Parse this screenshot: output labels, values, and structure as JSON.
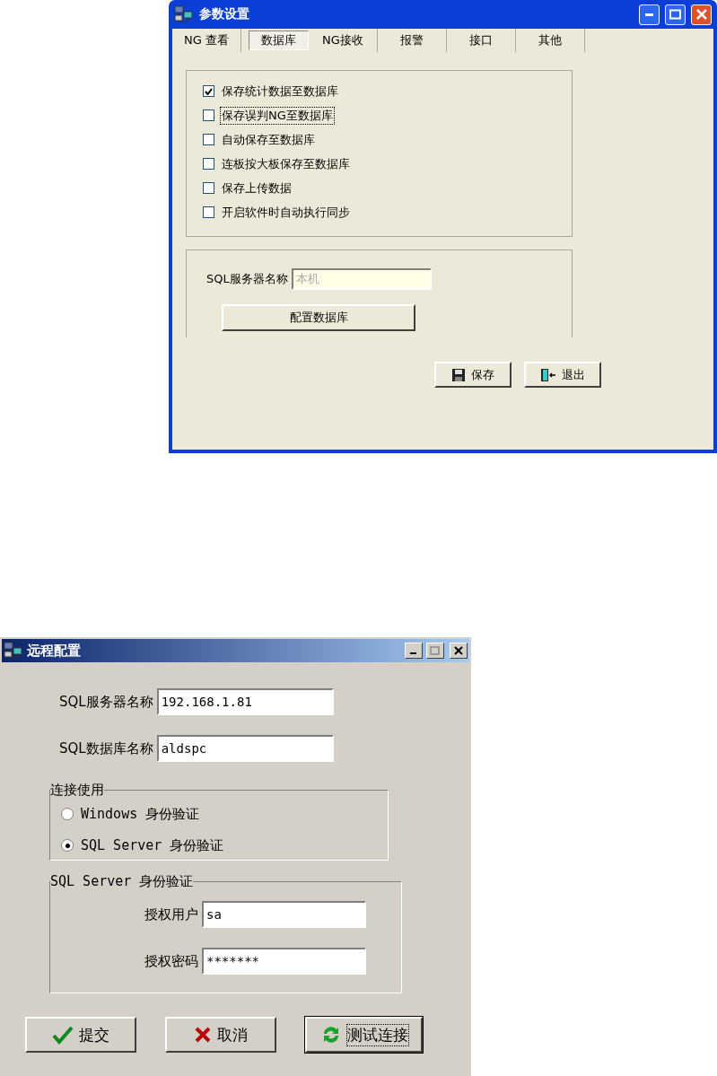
{
  "settings_window": {
    "title": "参数设置",
    "tabs": [
      {
        "label": "NG 查看",
        "selected": false
      },
      {
        "label": "数据库",
        "selected": true
      },
      {
        "label": "NG接收",
        "selected": false
      },
      {
        "label": "报警",
        "selected": false
      },
      {
        "label": "接口",
        "selected": false
      },
      {
        "label": "其他",
        "selected": false
      }
    ],
    "options": [
      {
        "label": "保存统计数据至数据库",
        "checked": true,
        "focused": false
      },
      {
        "label": "保存误判NG至数据库",
        "checked": false,
        "focused": true
      },
      {
        "label": "自动保存至数据库",
        "checked": false,
        "focused": false
      },
      {
        "label": "连板按大板保存至数据库",
        "checked": false,
        "focused": false
      },
      {
        "label": "保存上传数据",
        "checked": false,
        "focused": false
      },
      {
        "label": "开启软件时自动执行同步",
        "checked": false,
        "focused": false
      }
    ],
    "server": {
      "label": "SQL服务器名称",
      "value": "本机",
      "disabled": true
    },
    "configure_button": "配置数据库",
    "buttons": [
      {
        "label": "保存",
        "kind": "save"
      },
      {
        "label": "退出",
        "kind": "exit"
      }
    ]
  },
  "remote_window": {
    "title": "远程配置",
    "fields": [
      {
        "label": "SQL服务器名称",
        "value": "192.168.1.81"
      },
      {
        "label": "SQL数据库名称",
        "value": "aldspc"
      }
    ],
    "connection_group": {
      "title": "连接使用",
      "options": [
        {
          "label": "Windows 身份验证",
          "selected": false
        },
        {
          "label": "SQL Server 身份验证",
          "selected": true
        }
      ]
    },
    "auth_group": {
      "title": "SQL Server 身份验证",
      "fields": [
        {
          "label": "授权用户",
          "value": "sa"
        },
        {
          "label": "授权密码",
          "value": "*******"
        }
      ]
    },
    "buttons": [
      {
        "label": "提交",
        "kind": "submit",
        "focused": false
      },
      {
        "label": "取消",
        "kind": "cancel",
        "focused": false
      },
      {
        "label": "测试连接",
        "kind": "test",
        "focused": true
      }
    ]
  }
}
